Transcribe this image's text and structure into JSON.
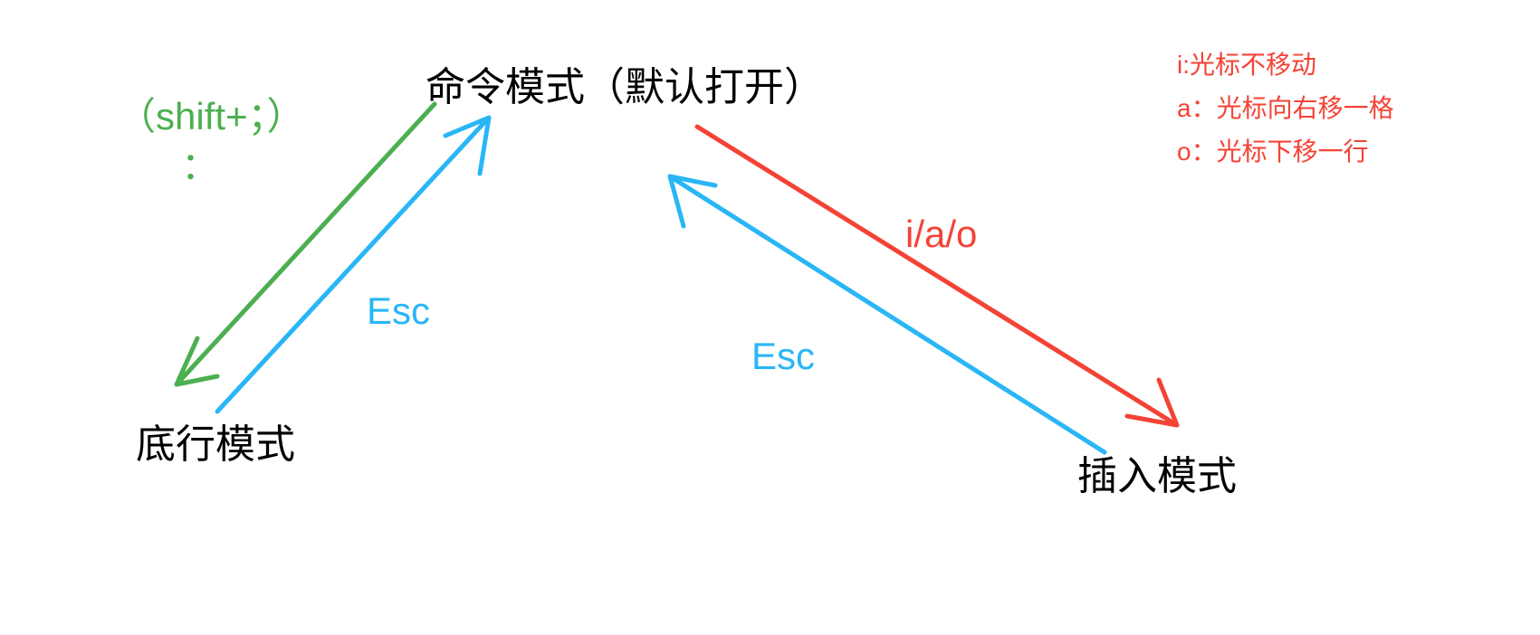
{
  "nodes": {
    "command_mode": "命令模式（默认打开）",
    "last_line_mode": "底行模式",
    "insert_mode": "插入模式"
  },
  "edges": {
    "shift_colon_line1": "（shift+；）",
    "shift_colon_line2": "：",
    "esc_left": "Esc",
    "esc_right": "Esc",
    "iao": "i/a/o"
  },
  "notes": {
    "i": "i:光标不移动",
    "a": "a：光标向右移一格",
    "o": "o：光标下移一行"
  },
  "colors": {
    "green": "#4caf50",
    "blue": "#29b6f6",
    "red": "#f44336",
    "black": "#000000"
  }
}
